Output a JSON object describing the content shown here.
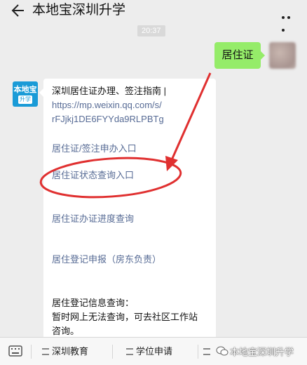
{
  "header": {
    "title": "本地宝深圳升学",
    "back_icon": "arrow-left-icon",
    "more_icon": "more-dots-icon"
  },
  "chat": {
    "timestamp": "20:37",
    "outgoing": {
      "text": "居住证",
      "bubble_color": "#95ec69"
    },
    "incoming_avatar": {
      "top": "本地宝",
      "bottom": "升学",
      "color": "#1a9bd7"
    },
    "incoming": {
      "intro_line1": "深圳居住证办理、签注指南 |",
      "intro_link1": "https://mp.weixin.qq.com/s/",
      "intro_link2": "rFJjkj1DE6FYYda9RLPBTg",
      "link_apply": "居住证/签注申办入口",
      "link_status": "居住证状态查询入口",
      "link_progress": "居住证办证进度查询",
      "link_register": "居住登记申报（房东负责）",
      "note_line1": "居住登记信息查询：",
      "note_line2": "暂时网上无法查询，可去社区工作站",
      "note_line3": "咨询。",
      "link_color": "#576b95"
    }
  },
  "annotation": {
    "color": "#e03030"
  },
  "bottom_menu": {
    "keyboard_icon": "keyboard-icon",
    "items": [
      {
        "label": "深圳教育"
      },
      {
        "label": "学位申请"
      },
      {
        "label": "深圳..."
      }
    ],
    "watermark": "本地宝深圳升学"
  }
}
